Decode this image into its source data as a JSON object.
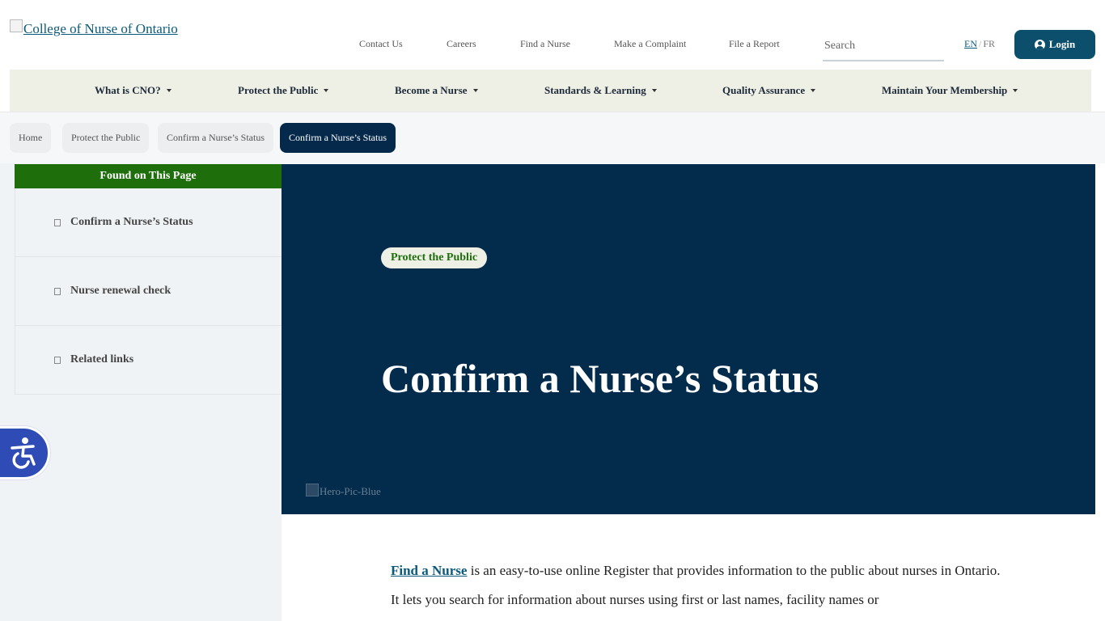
{
  "header": {
    "logo_alt": "College of Nurse of Ontario",
    "utility_nav": [
      "Contact Us",
      "Careers",
      "Find a Nurse",
      "Make a Complaint",
      "File a Report"
    ],
    "search_placeholder": "Search",
    "lang_en": "EN",
    "lang_sep": "/",
    "lang_fr": "FR",
    "login_label": "Login"
  },
  "main_nav": [
    "What is CNO?",
    "Protect the Public",
    "Become a Nurse",
    "Standards & Learning",
    "Quality Assurance",
    "Maintain Your Membership"
  ],
  "breadcrumbs": [
    "Home",
    "Protect the Public",
    "Confirm a Nurse’s Status",
    "Confirm a Nurse’s Status"
  ],
  "sidebar": {
    "toc_title": "Found on This Page",
    "items": [
      "Confirm a Nurse’s Status",
      "Nurse renewal check",
      "Related links"
    ]
  },
  "hero": {
    "tag": "Protect the Public",
    "title": "Confirm a Nurse’s Status",
    "image_alt": "Hero-Pic-Blue"
  },
  "content": {
    "link_text": "Find a Nurse",
    "paragraph_rest": " is an easy-to-use online Register that provides information to the public about nurses in Ontario. It lets you search for information about nurses using first or last names, facility names or"
  },
  "colors": {
    "accent_green": "#1e6e0c",
    "navy": "#022b4c",
    "login_blue": "#0b4f6c",
    "accessibility_blue": "#2f4bb5"
  },
  "icons": [
    "user-circle-icon",
    "caret-down-icon",
    "accessibility-icon",
    "chevron-right-icon"
  ]
}
